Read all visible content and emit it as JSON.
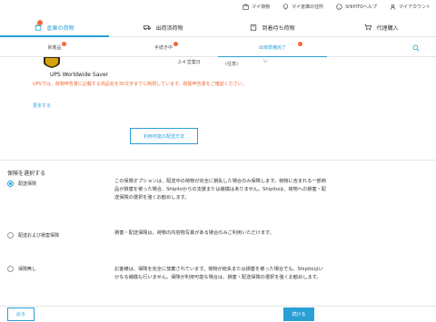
{
  "topbar": {
    "items": [
      {
        "label": "マイ荷物",
        "icon": "box-icon"
      },
      {
        "label": "マイ倉庫の住所",
        "icon": "location-icon"
      },
      {
        "label": "SHIPITOヘルプ",
        "icon": "help-icon"
      },
      {
        "label": "マイアカウント",
        "icon": "user-icon"
      }
    ]
  },
  "mainnav": {
    "items": [
      {
        "label": "倉庫の荷物",
        "icon": "warehouse-icon",
        "active": true
      },
      {
        "label": "出荷済荷物",
        "icon": "truck-icon",
        "active": false
      },
      {
        "label": "到着待ち荷物",
        "icon": "package-icon",
        "active": false
      },
      {
        "label": "代理購入",
        "icon": "cart-icon",
        "active": false
      }
    ],
    "badge_color": "#f26b3a"
  },
  "subnav": {
    "items": [
      {
        "label": "新着品",
        "active": false
      },
      {
        "label": "手続き中",
        "active": false
      },
      {
        "label": "出荷準備完了",
        "active": true
      }
    ]
  },
  "shipping": {
    "carrier": "UPS Worldwide Saver",
    "days_fragment": "2-4 営業日",
    "optional": "(任意)",
    "cut_text": "い",
    "warning": "UPSでは、荷物申告書に記載する商品名を30文字までに制限しています。税関申告書をご確認ください。",
    "more_link": "更多する",
    "available_methods_button": "利用可能の配送方法"
  },
  "insurance": {
    "title": "保険を選択する",
    "options": [
      {
        "label": "配送保険",
        "checked": true,
        "description": "この保険オプションは、配送中の荷物が完全に損失した場合のみ保障します。荷物に含まれる一部商品が損害を被った場合、Shipitoからの支援または補償はありません。Shipitoは、荷物への損害・配送保険の選択を強くお勧めします。"
      },
      {
        "label": "配送および損害保険",
        "checked": false,
        "description": "損害・配送保険は、荷物の内容物写真がある場合のみご利用いただけます。"
      },
      {
        "label": "保険無し",
        "checked": false,
        "description": "お客様は、保険を完全に放棄されています。荷物が紛失または損害を被った場合でも、Shipitoはいかなる補償も行いません。保険が利用可能な場合は、損害・配送保険の選択を強くお勧めします。"
      }
    ]
  },
  "footer": {
    "back_label": "戻る",
    "next_label": "続ける"
  },
  "colors": {
    "accent": "#2a9fd6",
    "warning": "#f26b3a"
  }
}
